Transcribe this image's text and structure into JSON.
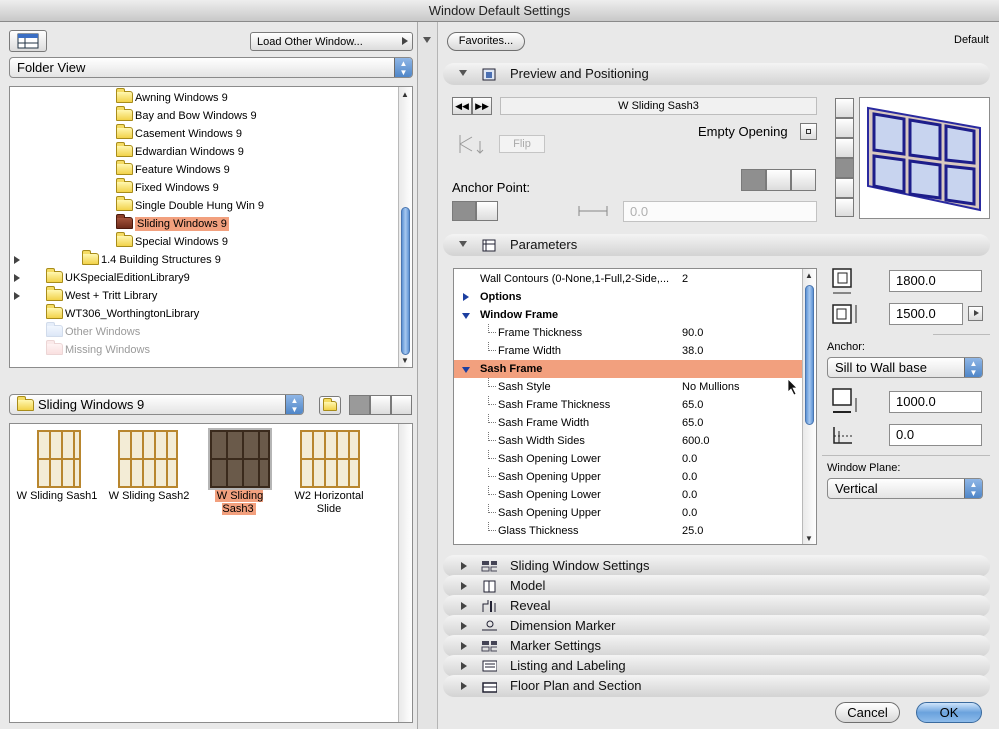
{
  "window": {
    "title": "Window Default Settings"
  },
  "left": {
    "load_other_window": "Load Other Window...",
    "folder_view": "Folder View",
    "tree": [
      {
        "label": "Awning Windows 9",
        "type": "folder"
      },
      {
        "label": "Bay and Bow Windows 9",
        "type": "folder"
      },
      {
        "label": "Casement Windows 9",
        "type": "folder"
      },
      {
        "label": "Edwardian Windows 9",
        "type": "folder"
      },
      {
        "label": "Feature Windows 9",
        "type": "folder"
      },
      {
        "label": "Fixed Windows 9",
        "type": "folder"
      },
      {
        "label": "Single Double Hung Win 9",
        "type": "folder"
      },
      {
        "label": "Sliding Windows 9",
        "type": "folder-selected"
      },
      {
        "label": "Special Windows 9",
        "type": "folder"
      },
      {
        "label": "1.4 Building Structures 9",
        "type": "folder-collapsed"
      },
      {
        "label": "UKSpecialEditionLibrary9",
        "type": "folder-collapsed"
      },
      {
        "label": "West + Tritt Library",
        "type": "folder-collapsed"
      },
      {
        "label": "WT306_WorthingtonLibrary",
        "type": "folder"
      },
      {
        "label": "Other Windows",
        "type": "ghost"
      },
      {
        "label": "Missing Windows",
        "type": "ghost-pink"
      }
    ],
    "current_folder": "Sliding Windows 9",
    "items": [
      {
        "label": "W Sliding Sash1"
      },
      {
        "label": "W Sliding Sash2"
      },
      {
        "label": "W Sliding Sash3",
        "selected": true
      },
      {
        "label_line1": "W2 Horizontal",
        "label_line2": "Slide"
      }
    ]
  },
  "right": {
    "favorites": "Favorites...",
    "default_label": "Default",
    "preview_section": "Preview and Positioning",
    "object_name": "W Sliding Sash3",
    "empty_opening": "Empty Opening",
    "flip": "Flip",
    "anchor_point": "Anchor Point:",
    "offset_value": "0.0",
    "parameters_section": "Parameters",
    "params": [
      {
        "name": "Wall Contours (0-None,1-Full,2-Side,...",
        "value": "2",
        "level": 0
      },
      {
        "name": "Options",
        "value": "",
        "level": 0,
        "toggle": "collapsed",
        "bold": true
      },
      {
        "name": "Window Frame",
        "value": "",
        "level": 0,
        "toggle": "expanded",
        "bold": true
      },
      {
        "name": "Frame Thickness",
        "value": "90.0",
        "level": 1
      },
      {
        "name": "Frame Width",
        "value": "38.0",
        "level": 1
      },
      {
        "name": "Sash Frame",
        "value": "",
        "level": 0,
        "toggle": "expanded",
        "bold": true,
        "selected": true
      },
      {
        "name": "Sash Style",
        "value": "No Mullions",
        "level": 1
      },
      {
        "name": "Sash Frame Thickness",
        "value": "65.0",
        "level": 1
      },
      {
        "name": "Sash Frame Width",
        "value": "65.0",
        "level": 1
      },
      {
        "name": "Sash Width Sides",
        "value": "600.0",
        "level": 1
      },
      {
        "name": "Sash Opening Lower",
        "value": "0.0",
        "level": 1
      },
      {
        "name": "Sash Opening Upper",
        "value": "0.0",
        "level": 1
      },
      {
        "name": "Sash Opening Lower",
        "value": "0.0",
        "level": 1
      },
      {
        "name": "Sash Opening Upper",
        "value": "0.0",
        "level": 1
      },
      {
        "name": "Glass Thickness",
        "value": "25.0",
        "level": 1
      }
    ],
    "width_value": "1800.0",
    "height_value": "1500.0",
    "anchor_label": "Anchor:",
    "anchor_select": "Sill to Wall base",
    "sill_value": "1000.0",
    "reveal_value": "0.0",
    "window_plane_label": "Window Plane:",
    "window_plane_select": "Vertical",
    "collapsed_sections": [
      "Sliding Window Settings",
      "Model",
      "Reveal",
      "Dimension Marker",
      "Marker Settings",
      "Listing and Labeling",
      "Floor Plan and Section"
    ],
    "cancel": "Cancel",
    "ok": "OK"
  }
}
